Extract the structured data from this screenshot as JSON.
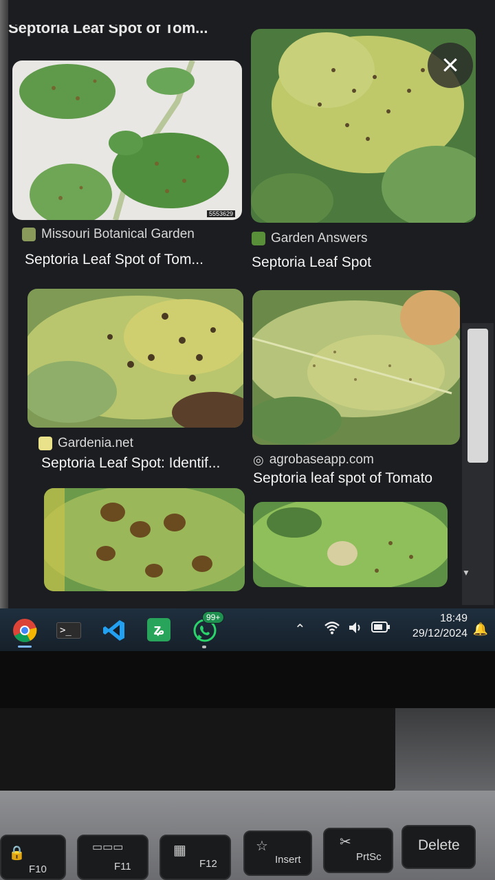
{
  "top_cut_title": "Septoria Leaf Spot of Tom...",
  "results": [
    {
      "source": "Missouri Botanical Garden",
      "title": "Septoria Leaf Spot of Tom...",
      "watermark": "5553629",
      "icon_color": "#8a9a5b"
    },
    {
      "source": "Garden Answers",
      "title": "Septoria Leaf Spot",
      "icon_color": "#5a8f3a"
    },
    {
      "source": "Gardenia.net",
      "title": "Septoria Leaf Spot: Identif...",
      "icon_color": "#e9e28a"
    },
    {
      "source": "agrobaseapp.com",
      "title": "Septoria leaf spot of Tomato",
      "icon": "globe-icon"
    }
  ],
  "close_icon": "×",
  "taskbar": {
    "apps": [
      "chrome-icon",
      "terminal-icon",
      "vscode-icon",
      "shortcut-icon",
      "whatsapp-icon"
    ],
    "whatsapp_badge": "99+",
    "time": "18:49",
    "date": "29/12/2024"
  },
  "keys": {
    "f10": "F10",
    "f11": "F11",
    "f12": "F12",
    "insert": "Insert",
    "prtsc": "PrtSc",
    "delete": "Delete"
  }
}
